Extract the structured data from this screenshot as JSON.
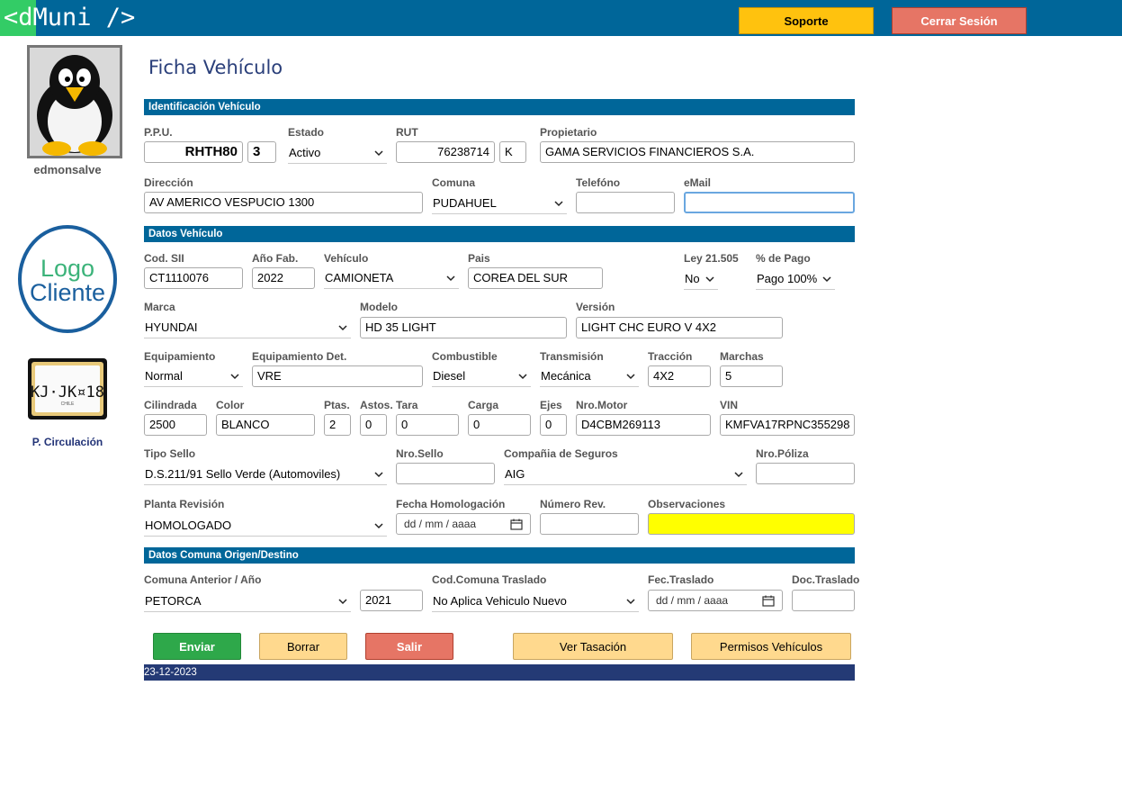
{
  "header": {
    "logo": "<dMuni />",
    "support_label": "Soporte",
    "logout_label": "Cerrar Sesión"
  },
  "sidebar": {
    "username": "edmonsalve",
    "client_logo": [
      "Logo",
      "Cliente"
    ],
    "plate_text": "KJ·JK¤18",
    "plate_country": "CHILE",
    "plate_label": "P. Circulación"
  },
  "page_title": "Ficha Vehículo",
  "sections": {
    "identification": "Identificación Vehículo",
    "vehicle": "Datos Vehículo",
    "commune": "Datos Comuna Origen/Destino"
  },
  "ident": {
    "ppu_label": "P.P.U.",
    "ppu": "RHTH80",
    "ppu_dv": "3",
    "estado_label": "Estado",
    "estado": "Activo",
    "rut_label": "RUT",
    "rut": "76238714",
    "rut_dv": "K",
    "propietario_label": "Propietario",
    "propietario": "GAMA SERVICIOS FINANCIEROS S.A.",
    "direccion_label": "Dirección",
    "direccion": "AV AMERICO VESPUCIO 1300",
    "comuna_label": "Comuna",
    "comuna": "PUDAHUEL",
    "telefono_label": "Telefóno",
    "telefono": "",
    "email_label": "eMail",
    "email": ""
  },
  "vehicle": {
    "cod_sii_label": "Cod. SII",
    "cod_sii": "CT1110076",
    "anio_label": "Año Fab.",
    "anio": "2022",
    "vehiculo_label": "Vehículo",
    "vehiculo": "CAMIONETA",
    "pais_label": "Pais",
    "pais": "COREA DEL SUR",
    "ley_label": "Ley 21.505",
    "ley": "No",
    "pago_label": "% de Pago",
    "pago": "Pago 100%",
    "marca_label": "Marca",
    "marca": "HYUNDAI",
    "modelo_label": "Modelo",
    "modelo": "HD 35 LIGHT",
    "version_label": "Versión",
    "version": "LIGHT CHC EURO V 4X2",
    "equip_label": "Equipamiento",
    "equip": "Normal",
    "equip_det_label": "Equipamiento Det.",
    "equip_det": "VRE",
    "combustible_label": "Combustible",
    "combustible": "Diesel",
    "transmision_label": "Transmisión",
    "transmision": "Mecánica",
    "traccion_label": "Tracción",
    "traccion": "4X2",
    "marchas_label": "Marchas",
    "marchas": "5",
    "cilindrada_label": "Cilindrada",
    "cilindrada": "2500",
    "color_label": "Color",
    "color": "BLANCO",
    "ptas_label": "Ptas.",
    "ptas": "2",
    "astos_label": "Astos.",
    "astos": "0",
    "tara_label": "Tara",
    "tara": "0",
    "carga_label": "Carga",
    "carga": "0",
    "ejes_label": "Ejes",
    "ejes": "0",
    "motor_label": "Nro.Motor",
    "motor": "D4CBM269113",
    "vin_label": "VIN",
    "vin": "KMFVA17RPNC355298",
    "sello_label": "Tipo Sello",
    "sello": "D.S.211/91 Sello Verde (Automoviles)",
    "nro_sello_label": "Nro.Sello",
    "nro_sello": "",
    "seguros_label": "Compañia de Seguros",
    "seguros": "AIG",
    "poliza_label": "Nro.Póliza",
    "poliza": "",
    "planta_label": "Planta Revisión",
    "planta": "HOMOLOGADO",
    "fecha_homol_label": "Fecha Homologación",
    "fecha_homol": "dd / mm / aaaa",
    "num_rev_label": "Número Rev.",
    "num_rev": "",
    "obs_label": "Observaciones",
    "obs": ""
  },
  "commune": {
    "anterior_label": "Comuna Anterior / Año",
    "anterior": "PETORCA",
    "anterior_anio": "2021",
    "traslado_label": "Cod.Comuna Traslado",
    "traslado": "No Aplica Vehiculo Nuevo",
    "fec_traslado_label": "Fec.Traslado",
    "fec_traslado": "dd / mm / aaaa",
    "doc_traslado_label": "Doc.Traslado",
    "doc_traslado": ""
  },
  "buttons": {
    "enviar": "Enviar",
    "borrar": "Borrar",
    "salir": "Salir",
    "tasacion": "Ver Tasación",
    "permisos": "Permisos Vehículos"
  },
  "footer_date": "23-12-2023",
  "colors": {
    "header_bg": "#006699",
    "logo_accent": "#33cc66",
    "section_bg": "#006699",
    "footer_bg": "#243a75",
    "observaciones_bg": "#ffff00"
  }
}
